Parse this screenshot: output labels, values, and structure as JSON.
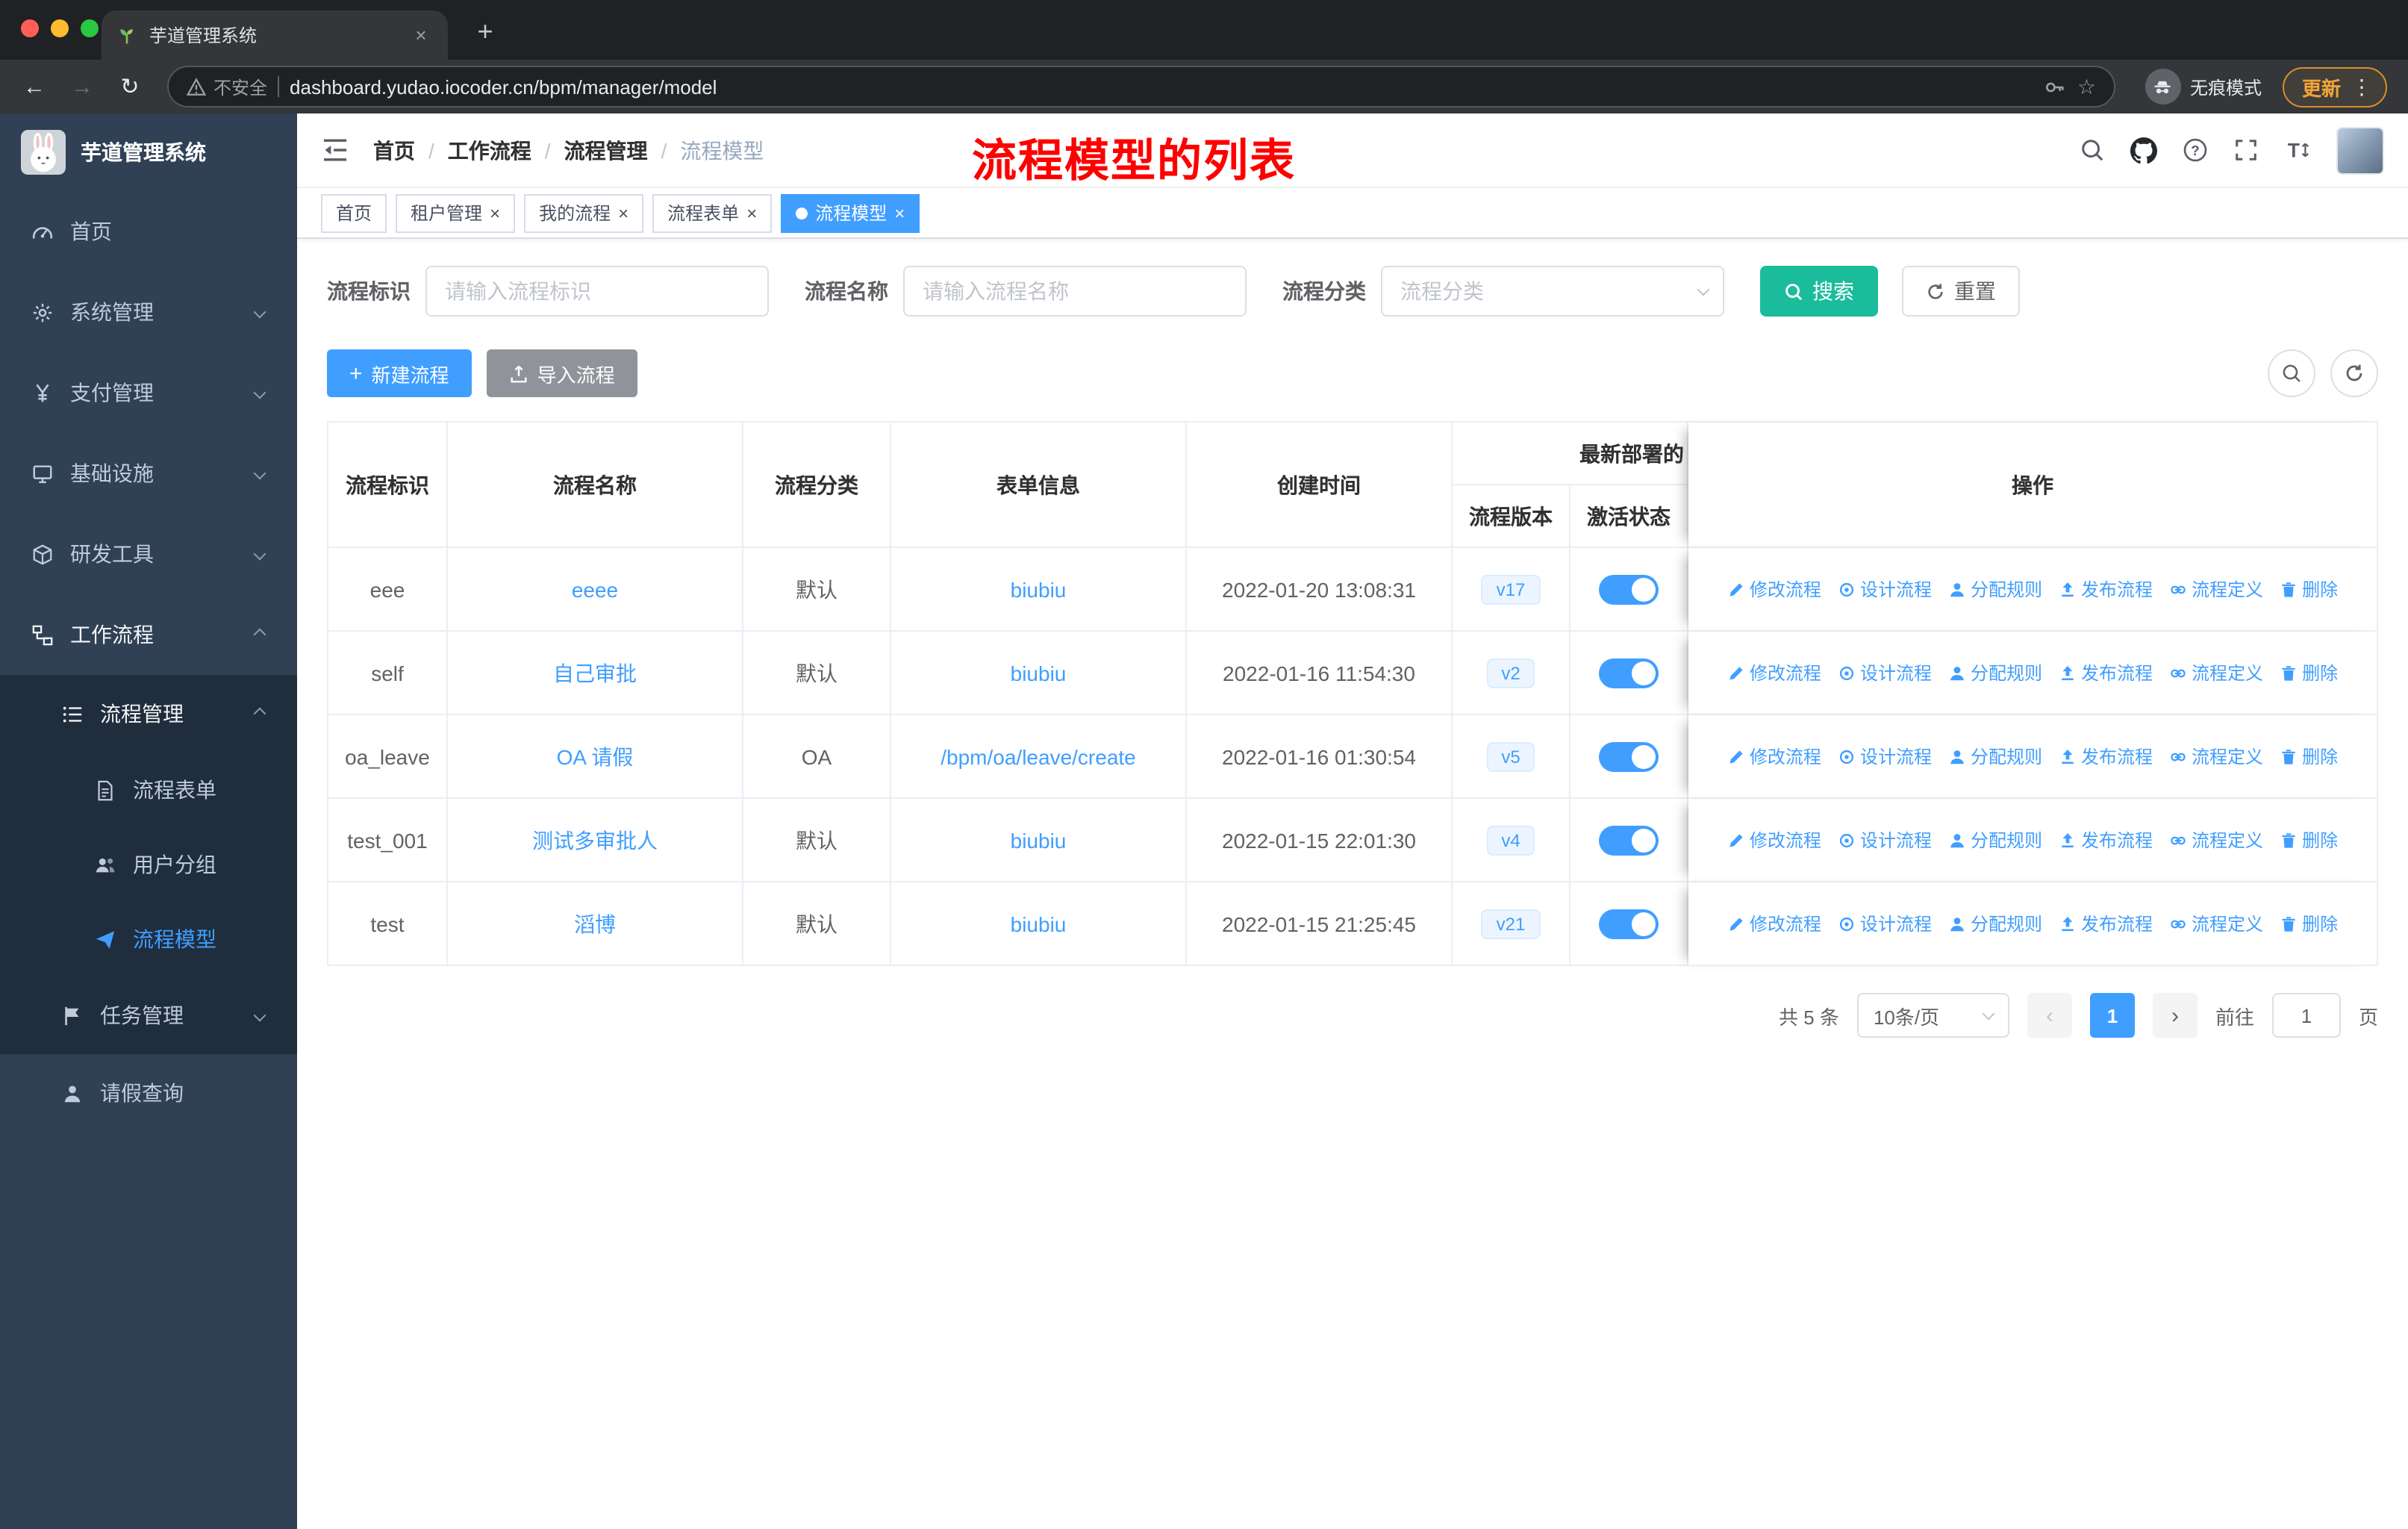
{
  "browser": {
    "tab_title": "芋道管理系统",
    "security_label": "不安全",
    "url": "dashboard.yudao.iocoder.cn/bpm/manager/model",
    "incognito_label": "无痕模式",
    "update_label": "更新"
  },
  "sidebar": {
    "logo_title": "芋道管理系统",
    "items": [
      {
        "label": "首页"
      },
      {
        "label": "系统管理"
      },
      {
        "label": "支付管理"
      },
      {
        "label": "基础设施"
      },
      {
        "label": "研发工具"
      },
      {
        "label": "工作流程"
      },
      {
        "label": "流程管理"
      },
      {
        "label": "流程表单"
      },
      {
        "label": "用户分组"
      },
      {
        "label": "流程模型"
      },
      {
        "label": "任务管理"
      },
      {
        "label": "请假查询"
      }
    ]
  },
  "header": {
    "breadcrumb": [
      "首页",
      "工作流程",
      "流程管理",
      "流程模型"
    ],
    "annotation": "流程模型的列表"
  },
  "tags": [
    {
      "label": "首页",
      "closable": false,
      "active": false
    },
    {
      "label": "租户管理",
      "closable": true,
      "active": false
    },
    {
      "label": "我的流程",
      "closable": true,
      "active": false
    },
    {
      "label": "流程表单",
      "closable": true,
      "active": false
    },
    {
      "label": "流程模型",
      "closable": true,
      "active": true
    }
  ],
  "filters": {
    "id_label": "流程标识",
    "id_placeholder": "请输入流程标识",
    "name_label": "流程名称",
    "name_placeholder": "请输入流程名称",
    "category_label": "流程分类",
    "category_placeholder": "流程分类",
    "search_label": "搜索",
    "reset_label": "重置"
  },
  "toolbar": {
    "create_label": "新建流程",
    "import_label": "导入流程"
  },
  "table": {
    "headers": {
      "id": "流程标识",
      "name": "流程名称",
      "category": "流程分类",
      "form": "表单信息",
      "created": "创建时间",
      "deploy_group": "最新部署的",
      "version": "流程版本",
      "active": "激活状态",
      "actions": "操作"
    },
    "action_labels": [
      "修改流程",
      "设计流程",
      "分配规则",
      "发布流程",
      "流程定义",
      "删除"
    ],
    "rows": [
      {
        "id": "eee",
        "name": "eeee",
        "category": "默认",
        "form": "biubiu",
        "created": "2022-01-20 13:08:31",
        "version": "v17",
        "active": true
      },
      {
        "id": "self",
        "name": "自己审批",
        "category": "默认",
        "form": "biubiu",
        "created": "2022-01-16 11:54:30",
        "version": "v2",
        "active": true
      },
      {
        "id": "oa_leave",
        "name": "OA 请假",
        "category": "OA",
        "form": "/bpm/oa/leave/create",
        "created": "2022-01-16 01:30:54",
        "version": "v5",
        "active": true
      },
      {
        "id": "test_001",
        "name": "测试多审批人",
        "category": "默认",
        "form": "biubiu",
        "created": "2022-01-15 22:01:30",
        "version": "v4",
        "active": true
      },
      {
        "id": "test",
        "name": "滔博",
        "category": "默认",
        "form": "biubiu",
        "created": "2022-01-15 21:25:45",
        "version": "v21",
        "active": true
      }
    ]
  },
  "pagination": {
    "total_label": "共 5 条",
    "page_size": "10条/页",
    "current_page": "1",
    "goto_label": "前往",
    "goto_value": "1",
    "page_unit": "页"
  },
  "colors": {
    "primary": "#409EFF",
    "search_button": "#1ABC9C",
    "sidebar_bg": "#304156",
    "submenu_bg": "#1F2D3D",
    "annotation_red": "#FF0000",
    "tag_bg": "#ECF5FF"
  }
}
